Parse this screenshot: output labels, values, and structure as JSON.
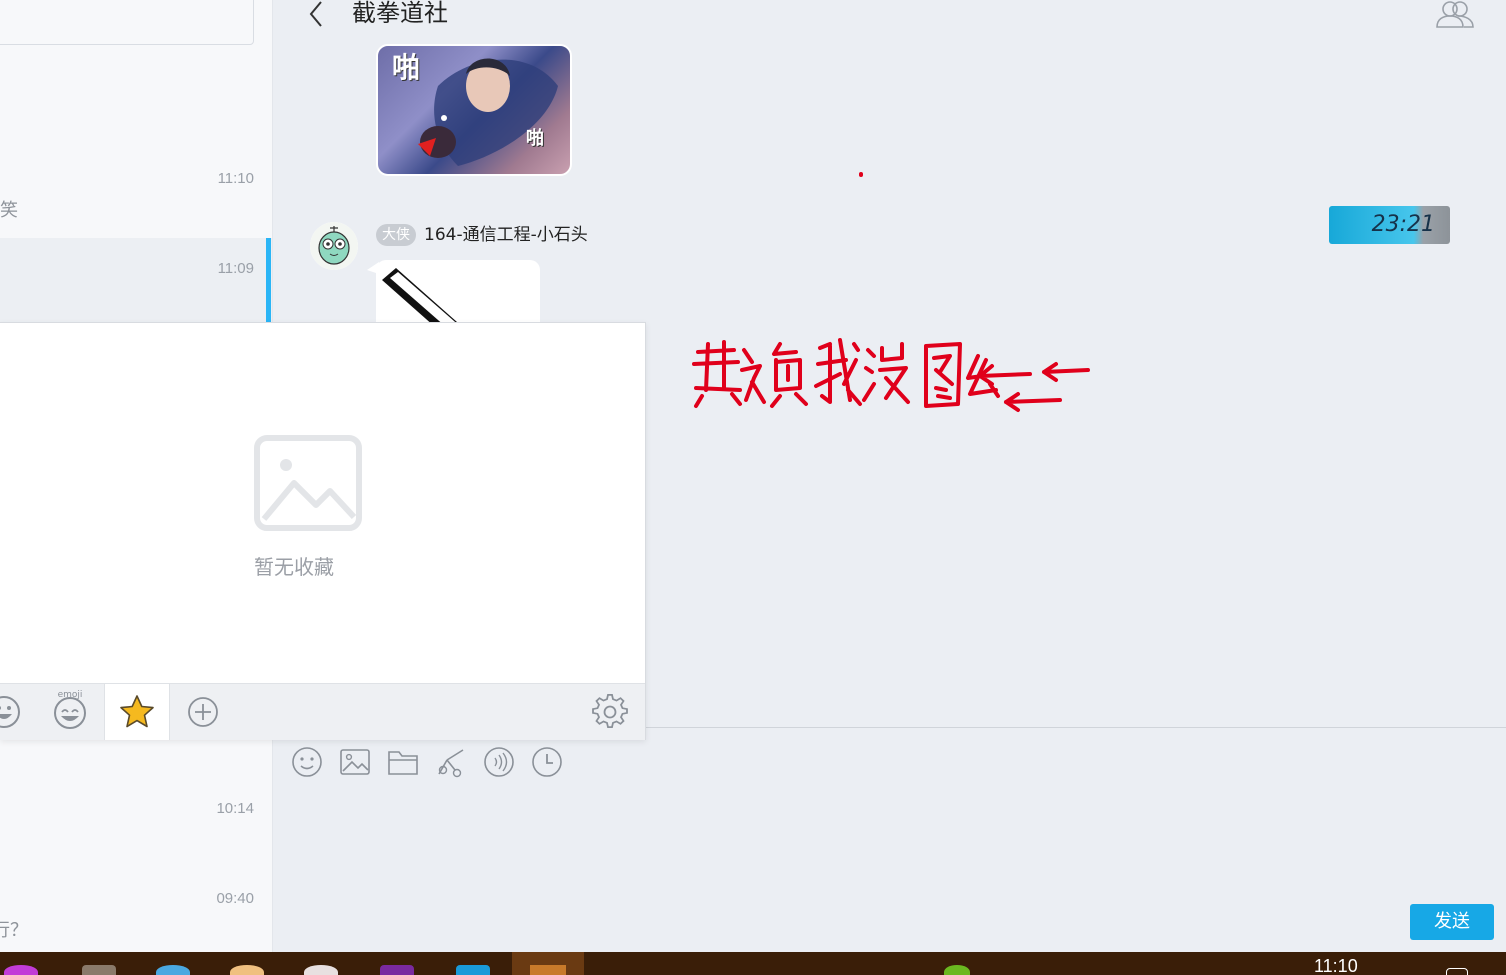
{
  "header": {
    "title": "截拳道社"
  },
  "sidebar": {
    "conversations": [
      {
        "time": "11:10",
        "preview": "笑"
      },
      {
        "time": "11:09",
        "preview": ""
      },
      {
        "time": "10:14",
        "preview": ""
      },
      {
        "time": "09:40",
        "preview": "行？"
      }
    ]
  },
  "messages": {
    "sticker": {
      "text_top": "啪",
      "text_bottom": "啪"
    },
    "sender_badge": "大侠",
    "sender_name": "164-通信工程-小石头"
  },
  "clock_widget": {
    "time": "23:21"
  },
  "annotation": {
    "text": "欺负我没图么",
    "color": "#e0001b"
  },
  "emoji_panel": {
    "empty_text": "暂无收藏",
    "tabs": [
      "emoji-face",
      "emoji",
      "favorites",
      "add",
      "settings"
    ],
    "active_tab": "favorites",
    "emoji_tab_label": "emoji"
  },
  "toolbar": {
    "icons": [
      "emoji-icon",
      "image-icon",
      "folder-icon",
      "screenshot-icon",
      "voice-icon",
      "history-icon"
    ]
  },
  "send_button": {
    "label": "发送"
  },
  "taskbar": {
    "time": "11:10"
  },
  "colors": {
    "accent": "#17a8e6",
    "active_bar": "#2ab5f6",
    "annotation": "#e0001b",
    "taskbar": "#3a1e08"
  }
}
